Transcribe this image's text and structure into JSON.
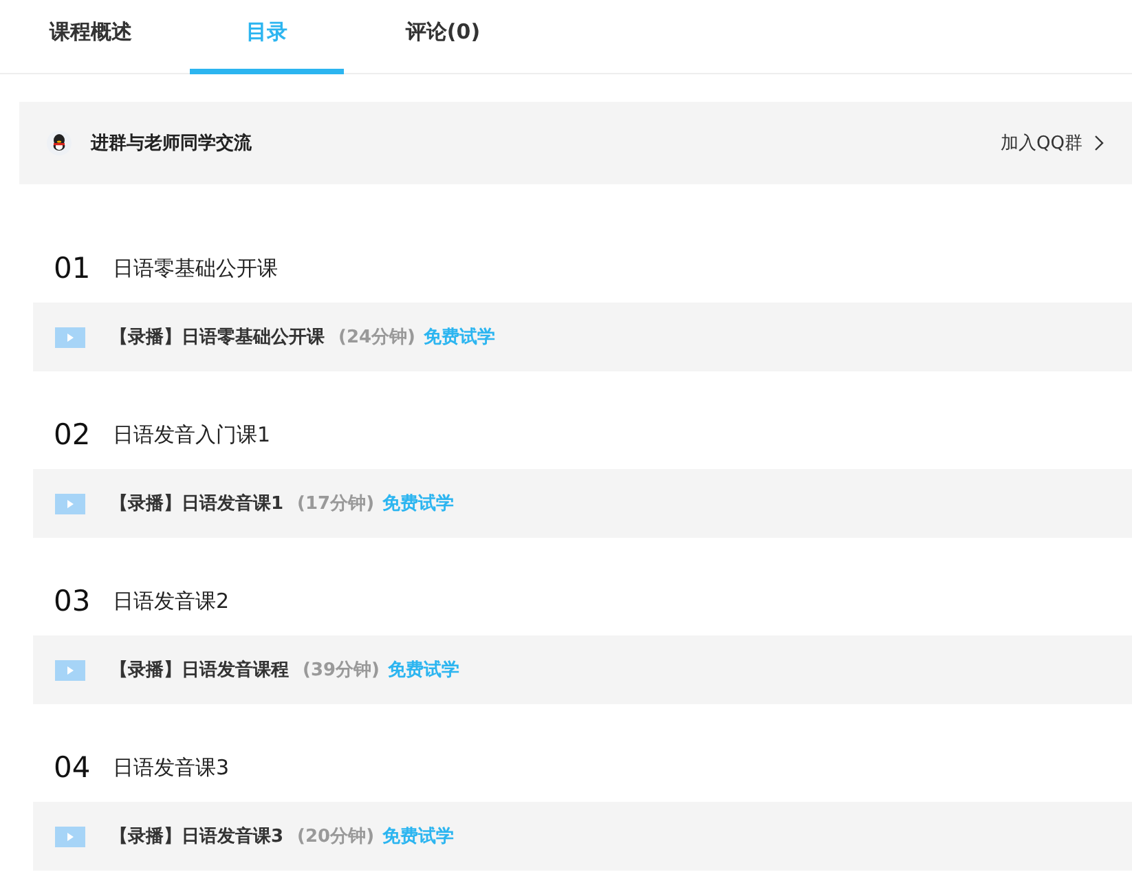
{
  "tabs": [
    {
      "label": "课程概述",
      "selected": false
    },
    {
      "label": "目录",
      "selected": true
    },
    {
      "label": "评论(0)",
      "selected": false
    }
  ],
  "group_banner": {
    "text": "进群与老师同学交流",
    "link": "加入QQ群"
  },
  "chapters": [
    {
      "number": "01",
      "title": "日语零基础公开课",
      "lessons": [
        {
          "title": "【录播】日语零基础公开课",
          "duration": "(24分钟)",
          "trial": "免费试学"
        }
      ]
    },
    {
      "number": "02",
      "title": "日语发音入门课1",
      "lessons": [
        {
          "title": "【录播】日语发音课1",
          "duration": "(17分钟)",
          "trial": "免费试学"
        }
      ]
    },
    {
      "number": "03",
      "title": "日语发音课2",
      "lessons": [
        {
          "title": "【录播】日语发音课程",
          "duration": "(39分钟)",
          "trial": "免费试学"
        }
      ]
    },
    {
      "number": "04",
      "title": "日语发音课3",
      "lessons": [
        {
          "title": "【录播】日语发音课3",
          "duration": "(20分钟)",
          "trial": "免费试学"
        }
      ]
    }
  ]
}
